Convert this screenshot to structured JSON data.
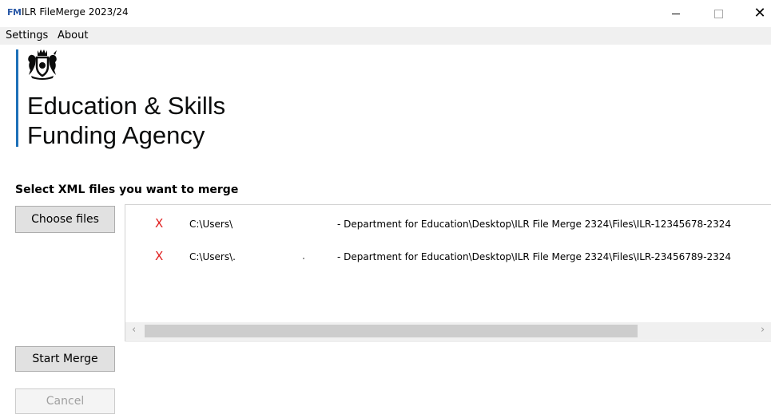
{
  "window": {
    "icon_text": "FM",
    "title": "ILR FileMerge 2023/24",
    "minimize_glyph": "",
    "close_glyph": "✕"
  },
  "menu": {
    "items": [
      {
        "label": "Settings"
      },
      {
        "label": "About"
      }
    ]
  },
  "logo": {
    "line1": "Education & Skills",
    "line2": "Funding Agency",
    "accent_color": "#1d70b8"
  },
  "main": {
    "heading": "Select XML files you want to merge",
    "choose_button": "Choose files",
    "start_button": "Start Merge",
    "cancel_button": "Cancel"
  },
  "files": [
    {
      "remove": "X",
      "path_start": "C:\\Users\\",
      "path_end": "- Department for Education\\Desktop\\ILR File Merge 2324\\Files\\ILR-12345678-2324"
    },
    {
      "remove": "X",
      "path_start": "C:\\Users\\.",
      "path_end": "- Department for Education\\Desktop\\ILR File Merge 2324\\Files\\ILR-23456789-2324"
    }
  ],
  "scrollbar": {
    "left_arrow": "‹",
    "right_arrow": "›"
  }
}
